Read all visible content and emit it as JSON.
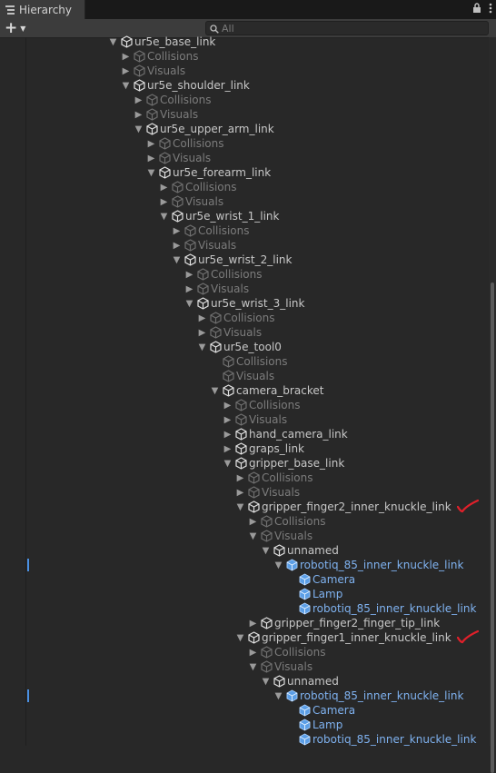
{
  "window": {
    "tab_title": "Hierarchy",
    "lock_icon": "lock-icon",
    "menu_icon": "kebab-menu-icon"
  },
  "toolbar": {
    "add_label": "+",
    "search_placeholder": "All"
  },
  "tree": [
    {
      "label": "ur5e_base_link",
      "depth": 0,
      "arrow": "open",
      "style": "normal"
    },
    {
      "label": "Collisions",
      "depth": 1,
      "arrow": "closed",
      "style": "dim"
    },
    {
      "label": "Visuals",
      "depth": 1,
      "arrow": "closed",
      "style": "dim"
    },
    {
      "label": "ur5e_shoulder_link",
      "depth": 1,
      "arrow": "open",
      "style": "normal"
    },
    {
      "label": "Collisions",
      "depth": 2,
      "arrow": "closed",
      "style": "dim"
    },
    {
      "label": "Visuals",
      "depth": 2,
      "arrow": "closed",
      "style": "dim"
    },
    {
      "label": "ur5e_upper_arm_link",
      "depth": 2,
      "arrow": "open",
      "style": "normal"
    },
    {
      "label": "Collisions",
      "depth": 3,
      "arrow": "closed",
      "style": "dim"
    },
    {
      "label": "Visuals",
      "depth": 3,
      "arrow": "closed",
      "style": "dim"
    },
    {
      "label": "ur5e_forearm_link",
      "depth": 3,
      "arrow": "open",
      "style": "normal"
    },
    {
      "label": "Collisions",
      "depth": 4,
      "arrow": "closed",
      "style": "dim"
    },
    {
      "label": "Visuals",
      "depth": 4,
      "arrow": "closed",
      "style": "dim"
    },
    {
      "label": "ur5e_wrist_1_link",
      "depth": 4,
      "arrow": "open",
      "style": "normal"
    },
    {
      "label": "Collisions",
      "depth": 5,
      "arrow": "closed",
      "style": "dim"
    },
    {
      "label": "Visuals",
      "depth": 5,
      "arrow": "closed",
      "style": "dim"
    },
    {
      "label": "ur5e_wrist_2_link",
      "depth": 5,
      "arrow": "open",
      "style": "normal"
    },
    {
      "label": "Collisions",
      "depth": 6,
      "arrow": "closed",
      "style": "dim"
    },
    {
      "label": "Visuals",
      "depth": 6,
      "arrow": "closed",
      "style": "dim"
    },
    {
      "label": "ur5e_wrist_3_link",
      "depth": 6,
      "arrow": "open",
      "style": "normal"
    },
    {
      "label": "Collisions",
      "depth": 7,
      "arrow": "closed",
      "style": "dim"
    },
    {
      "label": "Visuals",
      "depth": 7,
      "arrow": "closed",
      "style": "dim"
    },
    {
      "label": "ur5e_tool0",
      "depth": 7,
      "arrow": "open",
      "style": "normal"
    },
    {
      "label": "Collisions",
      "depth": 8,
      "arrow": "none",
      "style": "dim"
    },
    {
      "label": "Visuals",
      "depth": 8,
      "arrow": "none",
      "style": "dim"
    },
    {
      "label": "camera_bracket",
      "depth": 8,
      "arrow": "open",
      "style": "normal"
    },
    {
      "label": "Collisions",
      "depth": 9,
      "arrow": "closed",
      "style": "dim"
    },
    {
      "label": "Visuals",
      "depth": 9,
      "arrow": "closed",
      "style": "dim"
    },
    {
      "label": "hand_camera_link",
      "depth": 9,
      "arrow": "closed",
      "style": "normal"
    },
    {
      "label": "graps_link",
      "depth": 9,
      "arrow": "closed",
      "style": "normal"
    },
    {
      "label": "gripper_base_link",
      "depth": 9,
      "arrow": "open",
      "style": "normal"
    },
    {
      "label": "Collisions",
      "depth": 10,
      "arrow": "closed",
      "style": "dim"
    },
    {
      "label": "Visuals",
      "depth": 10,
      "arrow": "closed",
      "style": "dim"
    },
    {
      "label": "gripper_finger2_inner_knuckle_link",
      "depth": 10,
      "arrow": "open",
      "style": "normal",
      "checkmark": true
    },
    {
      "label": "Collisions",
      "depth": 11,
      "arrow": "closed",
      "style": "dim"
    },
    {
      "label": "Visuals",
      "depth": 11,
      "arrow": "open",
      "style": "dim"
    },
    {
      "label": "unnamed",
      "depth": 12,
      "arrow": "open",
      "style": "normal"
    },
    {
      "label": "robotiq_85_inner_knuckle_link",
      "depth": 13,
      "arrow": "open",
      "style": "prefab",
      "marker": true
    },
    {
      "label": "Camera",
      "depth": 14,
      "arrow": "none",
      "style": "prefab"
    },
    {
      "label": "Lamp",
      "depth": 14,
      "arrow": "none",
      "style": "prefab"
    },
    {
      "label": "robotiq_85_inner_knuckle_link",
      "depth": 14,
      "arrow": "none",
      "style": "prefab"
    },
    {
      "label": "gripper_finger2_finger_tip_link",
      "depth": 11,
      "arrow": "closed",
      "style": "normal"
    },
    {
      "label": "gripper_finger1_inner_knuckle_link",
      "depth": 10,
      "arrow": "open",
      "style": "normal",
      "checkmark": true
    },
    {
      "label": "Collisions",
      "depth": 11,
      "arrow": "closed",
      "style": "dim"
    },
    {
      "label": "Visuals",
      "depth": 11,
      "arrow": "open",
      "style": "dim"
    },
    {
      "label": "unnamed",
      "depth": 12,
      "arrow": "open",
      "style": "normal"
    },
    {
      "label": "robotiq_85_inner_knuckle_link",
      "depth": 13,
      "arrow": "open",
      "style": "prefab",
      "marker": true
    },
    {
      "label": "Camera",
      "depth": 14,
      "arrow": "none",
      "style": "prefab"
    },
    {
      "label": "Lamp",
      "depth": 14,
      "arrow": "none",
      "style": "prefab"
    },
    {
      "label": "robotiq_85_inner_knuckle_link",
      "depth": 14,
      "arrow": "none",
      "style": "prefab"
    }
  ],
  "colors": {
    "prefab_text": "#7fb2f0",
    "dim_text": "#7c7c7c",
    "annotation": "#e0202a"
  }
}
